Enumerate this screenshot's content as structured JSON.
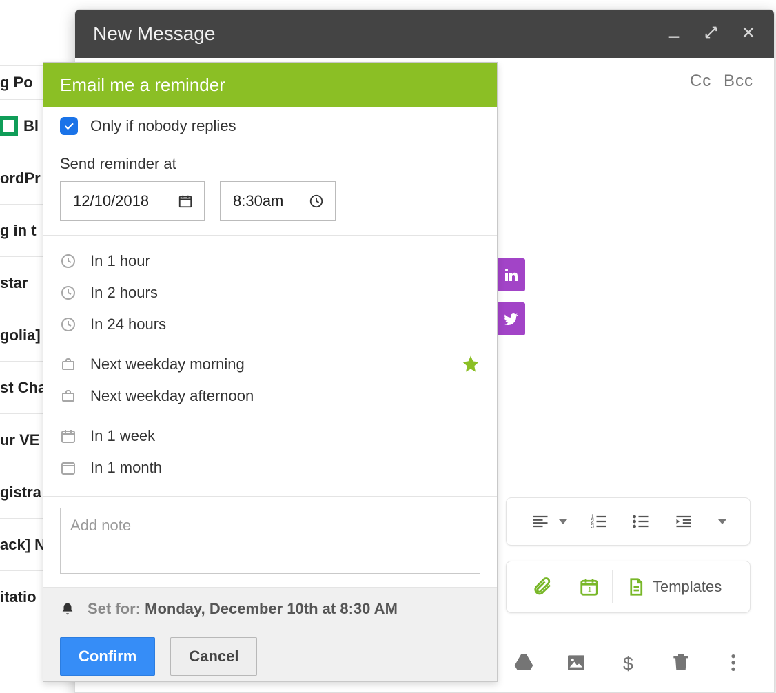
{
  "compose": {
    "title": "New Message",
    "cc_label": "Cc",
    "bcc_label": "Bcc"
  },
  "inbox_rows": [
    "g Po",
    "Bl",
    "ordPr",
    "g in t",
    "star",
    "golia]",
    "st Cha",
    "ur VE",
    "gistra",
    "ack] N",
    "itatio"
  ],
  "fmt": {
    "align": "align-left",
    "numbered_list": "numbered-list",
    "bulleted_list": "bulleted-list",
    "outdent": "outdent",
    "more": "more"
  },
  "green_tools": {
    "attach": "Attach files",
    "calendar": "Insert date",
    "templates_label": "Templates"
  },
  "grey_tools": {
    "drive": "Insert from Drive",
    "image": "Insert image",
    "money": "Send money",
    "trash": "Discard draft",
    "more": "More options"
  },
  "popup": {
    "header": "Email me a reminder",
    "only_if_no_reply": "Only if nobody replies",
    "only_if_no_reply_checked": true,
    "send_at_label": "Send reminder at",
    "date_value": "12/10/2018",
    "time_value": "8:30am",
    "presets": [
      {
        "icon": "clock",
        "label": "In 1 hour"
      },
      {
        "icon": "clock",
        "label": "In 2 hours"
      },
      {
        "icon": "clock",
        "label": "In 24 hours"
      },
      {
        "icon": "briefcase",
        "label": "Next weekday morning"
      },
      {
        "icon": "briefcase",
        "label": "Next weekday afternoon"
      },
      {
        "icon": "calendar",
        "label": "In 1 week"
      },
      {
        "icon": "calendar",
        "label": "In 1 month"
      }
    ],
    "note_placeholder": "Add note",
    "set_for_prefix": "Set for:",
    "set_for_value": "Monday, December 10th at 8:30 AM",
    "confirm_label": "Confirm",
    "cancel_label": "Cancel"
  },
  "social": {
    "linkedin": "LinkedIn",
    "twitter": "Twitter"
  }
}
